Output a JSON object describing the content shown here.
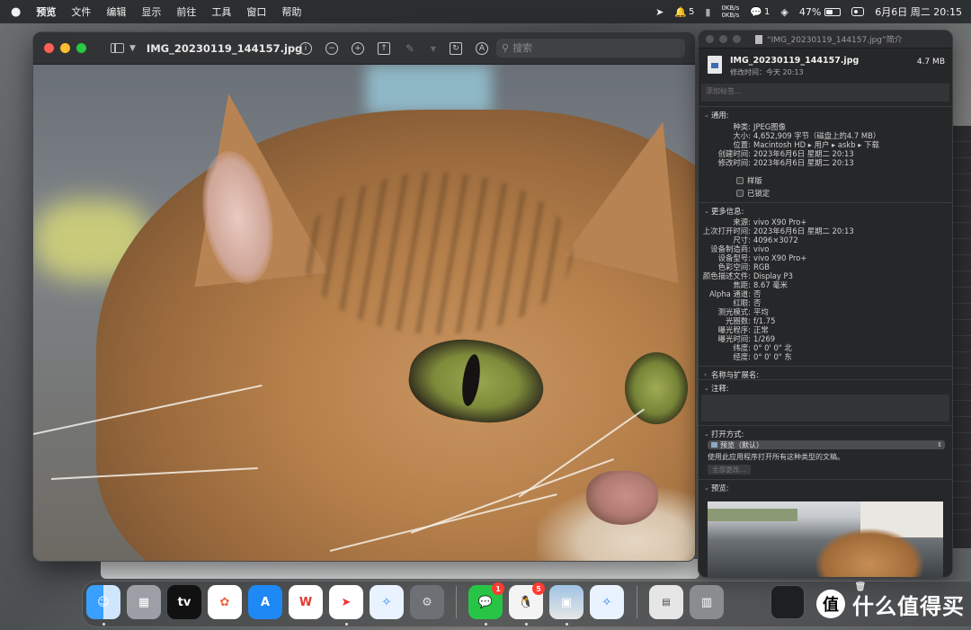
{
  "menubar": {
    "apple": "",
    "app": "预览",
    "menus": [
      "文件",
      "编辑",
      "显示",
      "前往",
      "工具",
      "窗口",
      "帮助"
    ],
    "status": {
      "bell_count": "5",
      "net_up": "0KB/s",
      "net_down": "0KB/s",
      "wechat_count": "1",
      "battery": "47%",
      "battery_level": 0.47,
      "datetime": "6月6日 周二  20:15"
    }
  },
  "preview": {
    "title": "IMG_20230119_144157.jpg",
    "search_placeholder": "搜索"
  },
  "info": {
    "window_title": "“IMG_20230119_144157.jpg”简介",
    "filename": "IMG_20230119_144157.jpg",
    "modified": "修改时间：今天 20:13",
    "size": "4.7 MB",
    "tags_placeholder": "添加标签…",
    "general": {
      "header": "通用:",
      "rows": [
        {
          "k": "种类:",
          "v": "JPEG图像"
        },
        {
          "k": "大小:",
          "v": "4,652,909 字节（磁盘上的4.7 MB）"
        },
        {
          "k": "位置:",
          "v": "Macintosh HD ▸ 用户 ▸ askb ▸ 下载"
        },
        {
          "k": "创建时间:",
          "v": "2023年6月6日 星期二 20:13"
        },
        {
          "k": "修改时间:",
          "v": "2023年6月6日 星期二 20:13"
        }
      ],
      "stationery": "样版",
      "locked": "已锁定"
    },
    "more": {
      "header": "更多信息:",
      "rows": [
        {
          "k": "来源:",
          "v": "vivo X90 Pro+"
        },
        {
          "k": "上次打开时间:",
          "v": "2023年6月6日 星期二 20:13"
        },
        {
          "k": "尺寸:",
          "v": "4096×3072"
        },
        {
          "k": "设备制造商:",
          "v": "vivo"
        },
        {
          "k": "设备型号:",
          "v": "vivo X90 Pro+"
        },
        {
          "k": "色彩空间:",
          "v": "RGB"
        },
        {
          "k": "颜色描述文件:",
          "v": "Display P3"
        },
        {
          "k": "焦距:",
          "v": "8.67 毫米"
        },
        {
          "k": "Alpha 通道:",
          "v": "否"
        },
        {
          "k": "红眼:",
          "v": "否"
        },
        {
          "k": "测光模式:",
          "v": "平均"
        },
        {
          "k": "光圈数:",
          "v": "f/1.75"
        },
        {
          "k": "曝光程序:",
          "v": "正常"
        },
        {
          "k": "曝光时间:",
          "v": "1/269"
        },
        {
          "k": "纬度:",
          "v": "0° 0' 0\" 北"
        },
        {
          "k": "经度:",
          "v": "0° 0' 0\" 东"
        }
      ]
    },
    "name_ext": "名称与扩展名:",
    "comments": "注释:",
    "open_with": {
      "header": "打开方式:",
      "app": "预览（默认）",
      "note": "使用此应用程序打开所有这种类型的文稿。",
      "change_all": "全部更改…"
    },
    "preview_header": "预览:"
  },
  "dock": {
    "badges": {
      "wechat": "1",
      "qq": "5"
    },
    "tv_label": "tv",
    "wps_label": "W",
    "watermark": "什么值得买",
    "watermark_logo": "值"
  }
}
